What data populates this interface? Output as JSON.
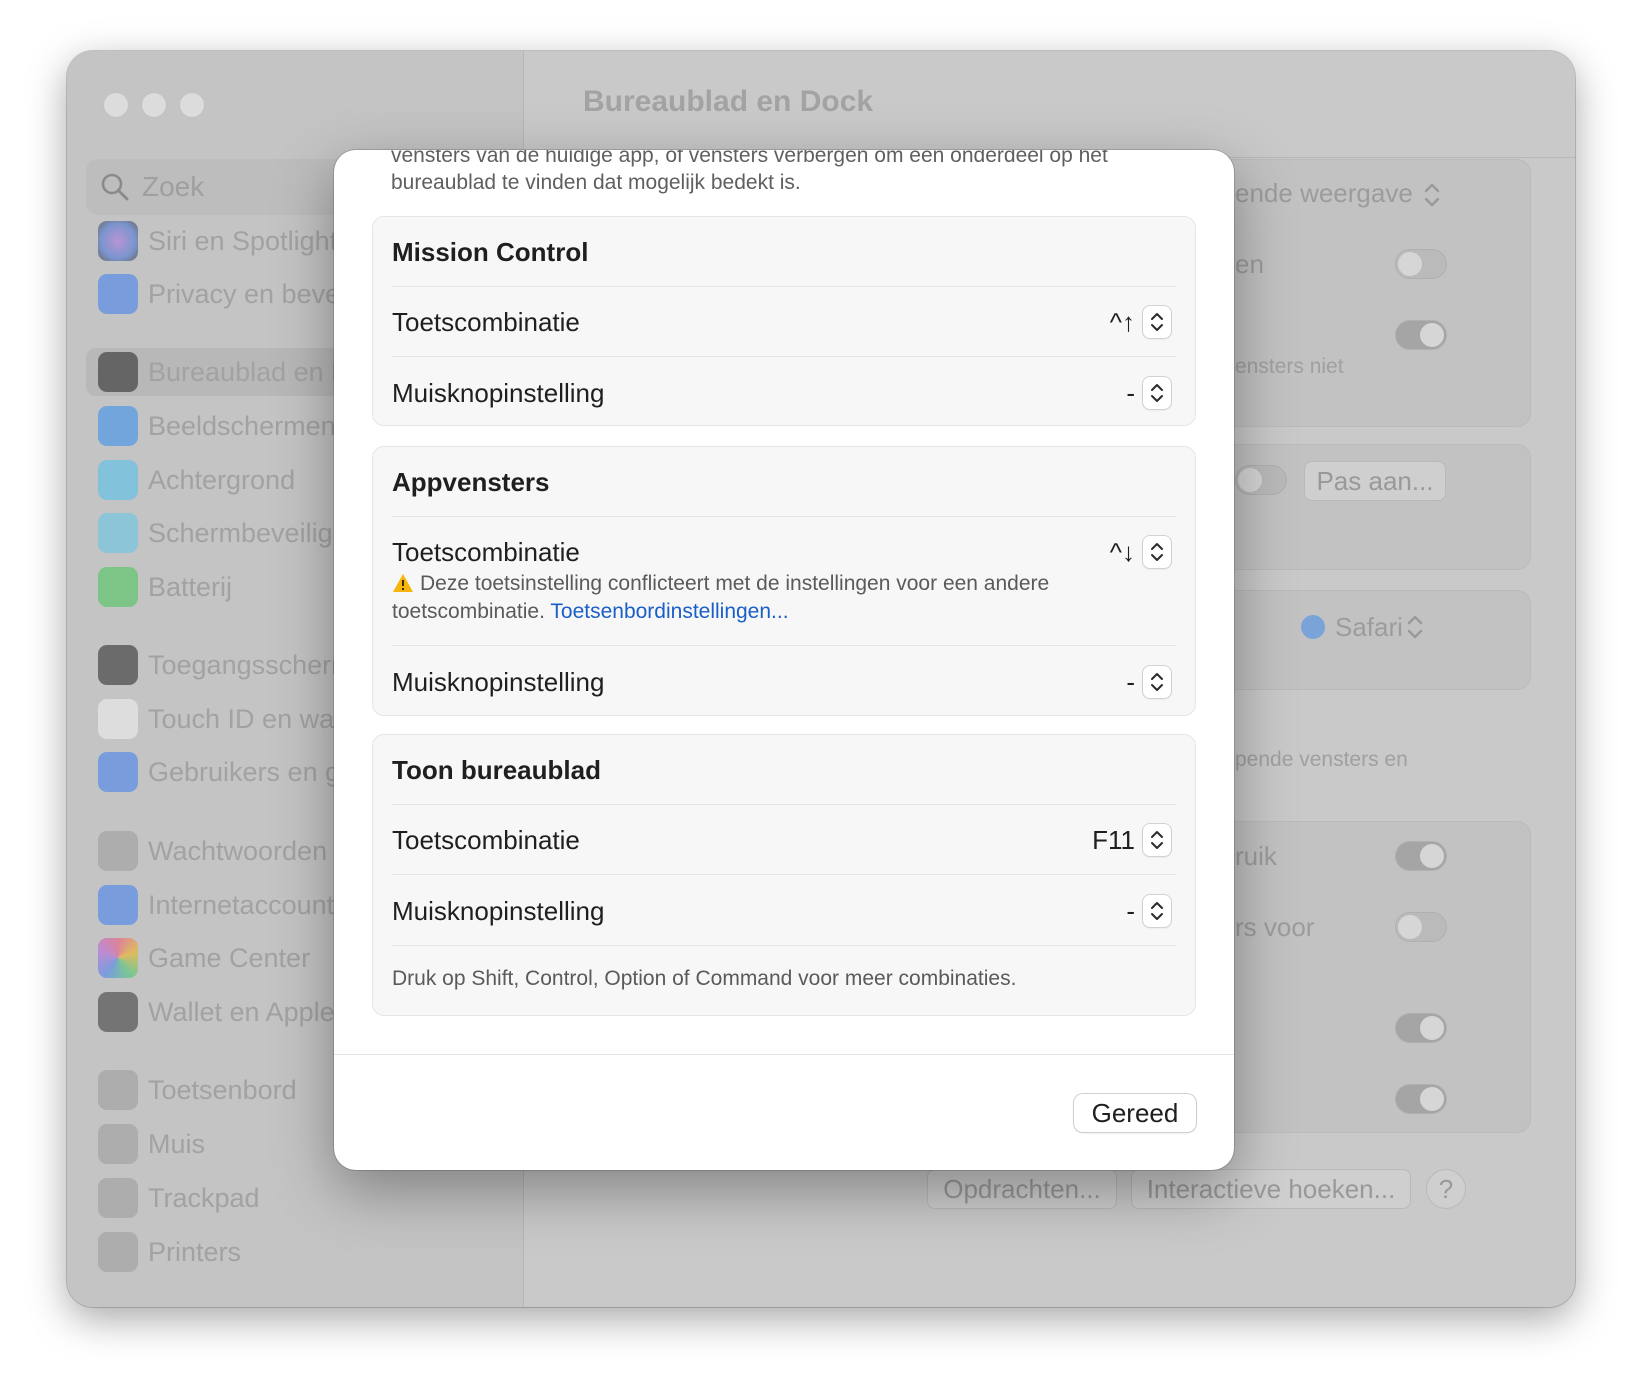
{
  "window": {
    "title": "Bureaublad en Dock"
  },
  "sidebar": {
    "search_placeholder": "Zoek",
    "items": [
      {
        "label": "Siri en Spotlight",
        "icon": "siri-icon"
      },
      {
        "label": "Privacy en beveiliging",
        "icon": "hand-icon"
      },
      {
        "label": "Bureaublad en Dock",
        "icon": "dock-icon",
        "selected": true
      },
      {
        "label": "Beeldschermen",
        "icon": "sun-icon"
      },
      {
        "label": "Achtergrond",
        "icon": "flower-icon"
      },
      {
        "label": "Schermbeveiliging",
        "icon": "screensaver-icon"
      },
      {
        "label": "Batterij",
        "icon": "battery-icon"
      },
      {
        "label": "Toegangsscherm",
        "icon": "lock-icon"
      },
      {
        "label": "Touch ID en wachtwoord",
        "icon": "fingerprint-icon"
      },
      {
        "label": "Gebruikers en groepen",
        "icon": "users-icon"
      },
      {
        "label": "Wachtwoorden",
        "icon": "key-icon"
      },
      {
        "label": "Internetaccounts",
        "icon": "at-icon"
      },
      {
        "label": "Game Center",
        "icon": "game-center-icon"
      },
      {
        "label": "Wallet en Apple Pay",
        "icon": "wallet-icon"
      },
      {
        "label": "Toetsenbord",
        "icon": "keyboard-icon"
      },
      {
        "label": "Muis",
        "icon": "mouse-icon"
      },
      {
        "label": "Trackpad",
        "icon": "trackpad-icon"
      },
      {
        "label": "Printers",
        "icon": "printer-icon"
      }
    ]
  },
  "background": {
    "popup_value_1": "ende weergave",
    "row_en": "en",
    "text_ensters_niet": "ensters niet",
    "pas_aan_button": "Pas aan...",
    "browser_value": "Safari",
    "text_pende": "pende vensters en",
    "row_ruik": "ruik",
    "row_rs_voor": "rs voor",
    "opdrachten_button": "Opdrachten...",
    "interactieve_button": "Interactieve hoeken...",
    "help_button": "?",
    "toggles": [
      false,
      true,
      false,
      true,
      false,
      true,
      true
    ]
  },
  "dialog": {
    "intro_line_1": "vensters van de huidige app, of vensters verbergen om een onderdeel op het",
    "intro_line_2": "bureaublad te vinden dat mogelijk bedekt is.",
    "sections": [
      {
        "title": "Mission Control",
        "shortcut_label": "Toetscombinatie",
        "shortcut_value": "^↑",
        "mouse_label": "Muisknopinstelling",
        "mouse_value": "-"
      },
      {
        "title": "Appvensters",
        "shortcut_label": "Toetscombinatie",
        "shortcut_value": "^↓",
        "warning_text": "Deze toetsinstelling conflicteert met de instellingen voor een andere toetscombinatie.",
        "warning_link": "Toetsenbordinstellingen...",
        "mouse_label": "Muisknopinstelling",
        "mouse_value": "-"
      },
      {
        "title": "Toon bureaublad",
        "shortcut_label": "Toetscombinatie",
        "shortcut_value": "F11",
        "mouse_label": "Muisknopinstelling",
        "mouse_value": "-",
        "footnote": "Druk op Shift, Control, Option of Command voor meer combinaties."
      }
    ],
    "done_button": "Gereed"
  },
  "colors": {
    "link": "#1a5fc8",
    "warning": "#f5b50a"
  }
}
